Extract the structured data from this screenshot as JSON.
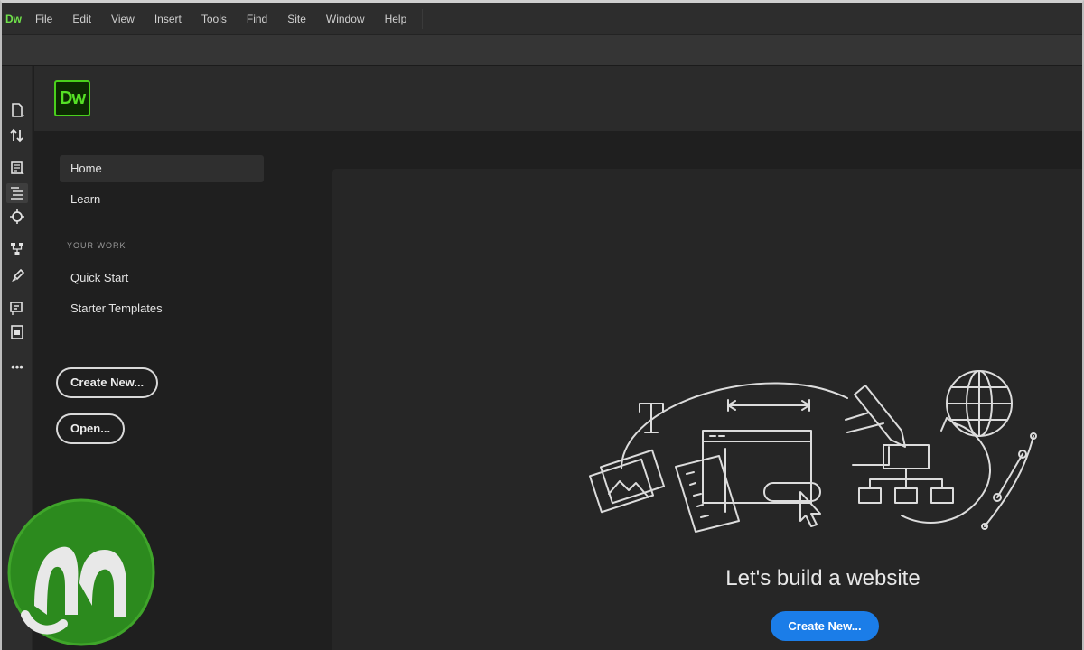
{
  "menu": {
    "app_icon": "Dw",
    "items": [
      "File",
      "Edit",
      "View",
      "Insert",
      "Tools",
      "Find",
      "Site",
      "Window",
      "Help"
    ]
  },
  "toolbar": {
    "icons": [
      "new-document-icon",
      "file-transfer-icon",
      "document-icon",
      "files-panel-icon",
      "live-view-icon",
      "structure-icon",
      "brush-icon",
      "code-panel-icon",
      "assets-icon",
      "more-icon"
    ],
    "more_label": "•••"
  },
  "home": {
    "logo": "Dw",
    "nav": {
      "home": "Home",
      "learn": "Learn"
    },
    "section_label": "YOUR WORK",
    "work": {
      "quick_start": "Quick Start",
      "starter_templates": "Starter Templates"
    },
    "create_new": "Create New...",
    "open": "Open...",
    "hero": {
      "tagline": "Let's build a website",
      "button": "Create New..."
    }
  },
  "colors": {
    "accent_blue": "#1b7de8",
    "brand_green": "#4ad11c",
    "background": "#1f1f1f"
  }
}
